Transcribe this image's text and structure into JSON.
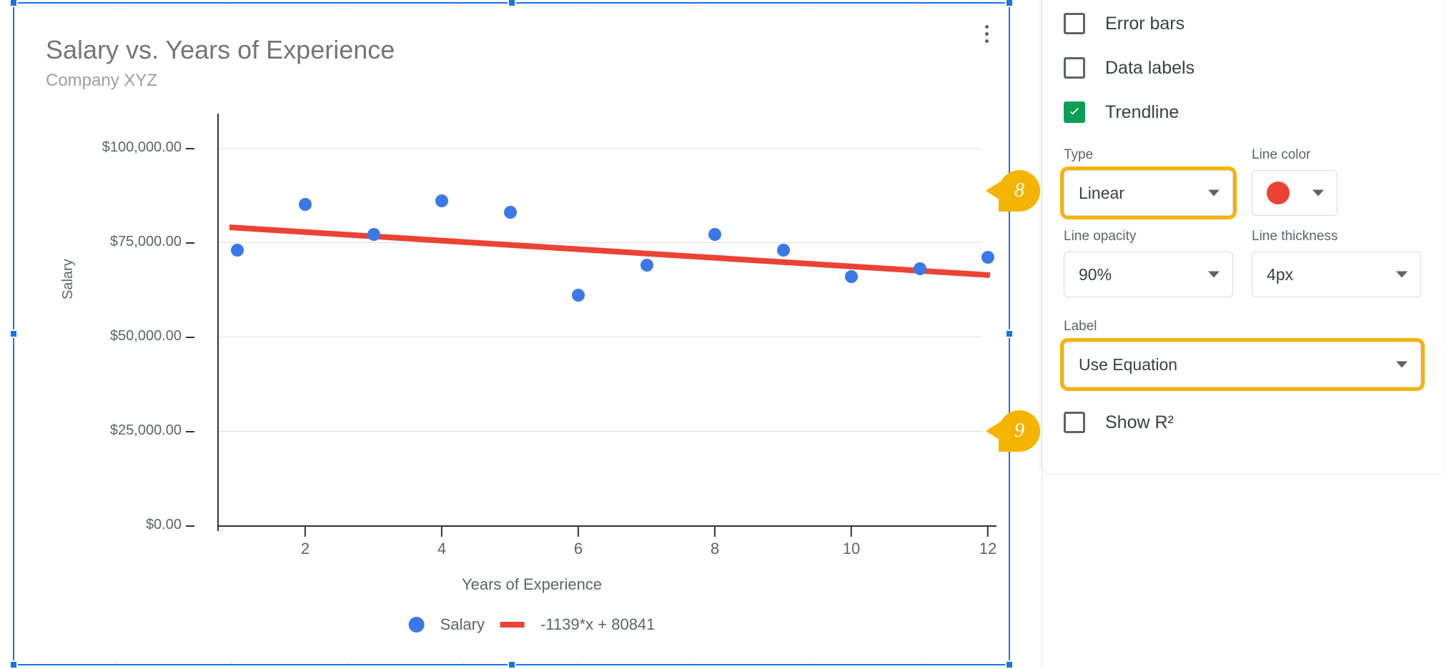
{
  "chart_data": {
    "type": "scatter",
    "title": "Salary vs. Years of Experience",
    "subtitle": "Company XYZ",
    "xlabel": "Years of Experience",
    "ylabel": "Salary",
    "xlim": [
      1,
      12
    ],
    "ylim": [
      0,
      100000
    ],
    "x_ticks": [
      2,
      4,
      6,
      8,
      10,
      12
    ],
    "y_ticks": [
      "$0.00",
      "$25,000.00",
      "$50,000.00",
      "$75,000.00",
      "$100,000.00"
    ],
    "series": [
      {
        "name": "Salary",
        "x": [
          1,
          2,
          3,
          4,
          5,
          6,
          7,
          8,
          9,
          10,
          11,
          12
        ],
        "y": [
          73000,
          85000,
          77000,
          86000,
          83000,
          61000,
          69000,
          77000,
          73000,
          66000,
          68000,
          71000
        ]
      }
    ],
    "trendline": {
      "slope": -1139,
      "intercept": 80841,
      "equation": "-1139*x + 80841",
      "color": "#ea4335"
    }
  },
  "chart": {
    "title": "Salary vs. Years of Experience",
    "subtitle": "Company XYZ",
    "xlabel": "Years of Experience",
    "ylabel": "Salary",
    "legend_series": "Salary",
    "legend_trend": "-1139*x + 80841",
    "y_ticks": [
      "$0.00",
      "$25,000.00",
      "$50,000.00",
      "$75,000.00",
      "$100,000.00"
    ],
    "x_ticks": [
      "2",
      "4",
      "6",
      "8",
      "10",
      "12"
    ]
  },
  "sidebar": {
    "error_bars": "Error bars",
    "data_labels": "Data labels",
    "trendline": "Trendline",
    "type_label": "Type",
    "type_value": "Linear",
    "line_color_label": "Line color",
    "line_color_value": "#ea4335",
    "opacity_label": "Line opacity",
    "opacity_value": "90%",
    "thickness_label": "Line thickness",
    "thickness_value": "4px",
    "label_label": "Label",
    "label_value": "Use Equation",
    "show_r2": "Show R²"
  },
  "callouts": {
    "a": "8",
    "b": "9"
  }
}
